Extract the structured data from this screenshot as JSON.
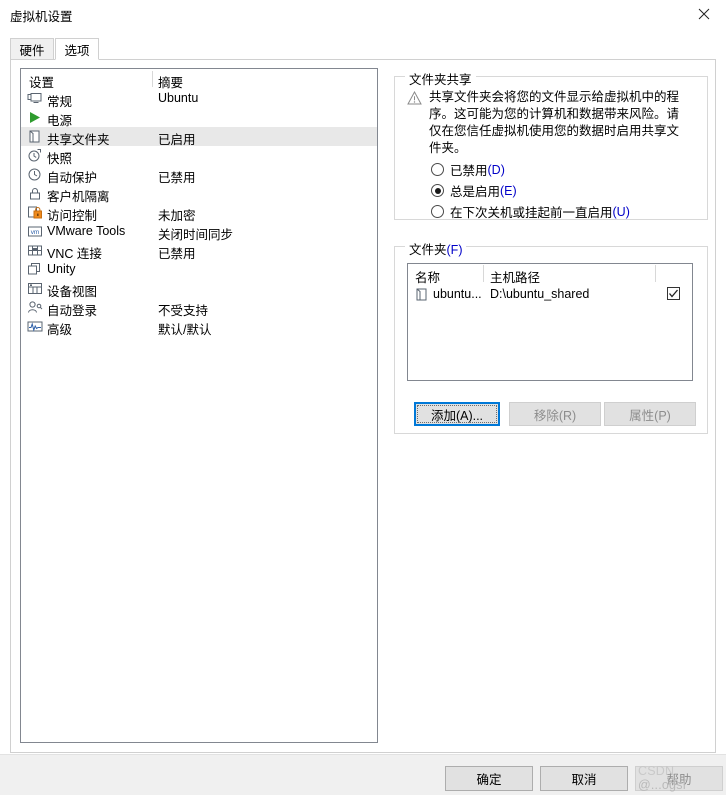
{
  "window": {
    "title": "虚拟机设置",
    "close_icon": "close-icon"
  },
  "tabs": [
    {
      "label": "硬件",
      "active": false
    },
    {
      "label": "选项",
      "active": true
    }
  ],
  "settings_list": {
    "columns": [
      "设置",
      "摘要"
    ],
    "rows": [
      {
        "icon": "monitor-icon",
        "label": "常规",
        "summary": "Ubuntu",
        "selected": false
      },
      {
        "icon": "power-play-icon",
        "label": "电源",
        "summary": "",
        "selected": false
      },
      {
        "icon": "shared-folder-icon",
        "label": "共享文件夹",
        "summary": "已启用",
        "selected": true
      },
      {
        "icon": "snapshot-icon",
        "label": "快照",
        "summary": "",
        "selected": false
      },
      {
        "icon": "autoprotect-icon",
        "label": "自动保护",
        "summary": "已禁用",
        "selected": false
      },
      {
        "icon": "lock-icon",
        "label": "客户机隔离",
        "summary": "",
        "selected": false
      },
      {
        "icon": "access-control-icon",
        "label": "访问控制",
        "summary": "未加密",
        "selected": false
      },
      {
        "icon": "vmware-tools-icon",
        "label": "VMware Tools",
        "summary": "关闭时间同步",
        "selected": false
      },
      {
        "icon": "vnc-icon",
        "label": "VNC 连接",
        "summary": "已禁用",
        "selected": false
      },
      {
        "icon": "unity-icon",
        "label": "Unity",
        "summary": "",
        "selected": false
      },
      {
        "icon": "device-view-icon",
        "label": "设备视图",
        "summary": "",
        "selected": false
      },
      {
        "icon": "auto-login-icon",
        "label": "自动登录",
        "summary": "不受支持",
        "selected": false
      },
      {
        "icon": "advanced-icon",
        "label": "高级",
        "summary": "默认/默认",
        "selected": false
      }
    ]
  },
  "folder_sharing": {
    "group_title": "文件夹共享",
    "warning_icon": "warning-triangle-icon",
    "warning_text": "共享文件夹会将您的文件显示给虚拟机中的程序。这可能为您的计算机和数据带来风险。请仅在您信任虚拟机使用您的数据时启用共享文件夹。",
    "options": [
      {
        "label": "已禁用(D)",
        "text": "已禁用",
        "accel": "(D)",
        "checked": false
      },
      {
        "label": "总是启用(E)",
        "text": "总是启用",
        "accel": "(E)",
        "checked": true
      },
      {
        "label": "在下次关机或挂起前一直启用(U)",
        "text": "在下次关机或挂起前一直启用",
        "accel": "(U)",
        "checked": false
      }
    ]
  },
  "folders": {
    "group_title": "文件夹(F)",
    "group_title_text": "文件夹",
    "group_title_accel": "(F)",
    "columns": [
      "名称",
      "主机路径",
      ""
    ],
    "rows": [
      {
        "icon": "folder-icon",
        "name": "ubuntu...",
        "path": "D:\\ubuntu_shared",
        "enabled": true,
        "check_icon": "check-icon"
      }
    ],
    "buttons": [
      {
        "label": "添加(A)...",
        "state": "focused"
      },
      {
        "label": "移除(R)",
        "state": "disabled"
      },
      {
        "label": "属性(P)",
        "state": "disabled"
      }
    ]
  },
  "dialog_buttons": [
    {
      "label": "确定",
      "state": "normal"
    },
    {
      "label": "取消",
      "state": "normal"
    },
    {
      "label": "帮助",
      "state": "disabled"
    }
  ],
  "watermark": {
    "prefix": "CSDN ",
    "suffix": "@...ogsf"
  }
}
